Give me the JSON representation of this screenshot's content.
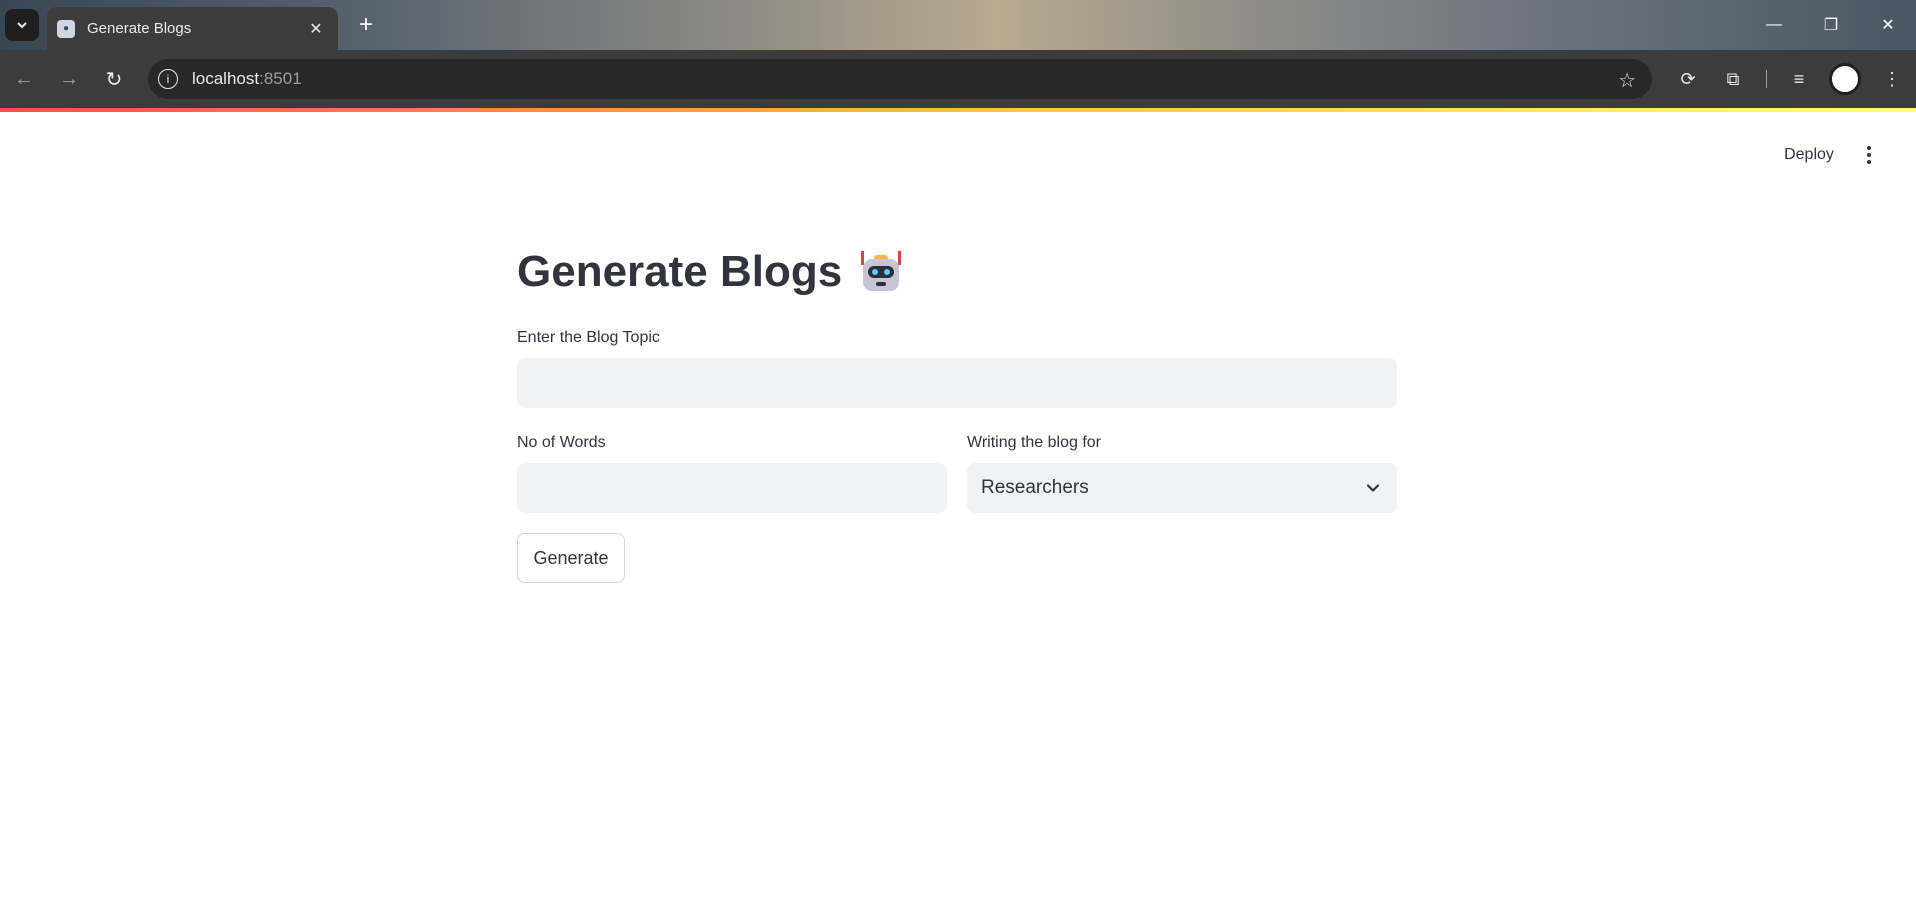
{
  "browser": {
    "tab_title": "Generate Blogs",
    "url_host": "localhost",
    "url_port": ":8501"
  },
  "app": {
    "deploy_label": "Deploy",
    "title": "Generate Blogs",
    "topic_label": "Enter the Blog Topic",
    "topic_value": "",
    "words_label": "No of Words",
    "words_value": "",
    "audience_label": "Writing the blog for",
    "audience_selected": "Researchers",
    "generate_label": "Generate"
  },
  "colors": {
    "accent": "#ff4b4b",
    "text": "#31333f",
    "input_bg": "#f0f2f6"
  }
}
